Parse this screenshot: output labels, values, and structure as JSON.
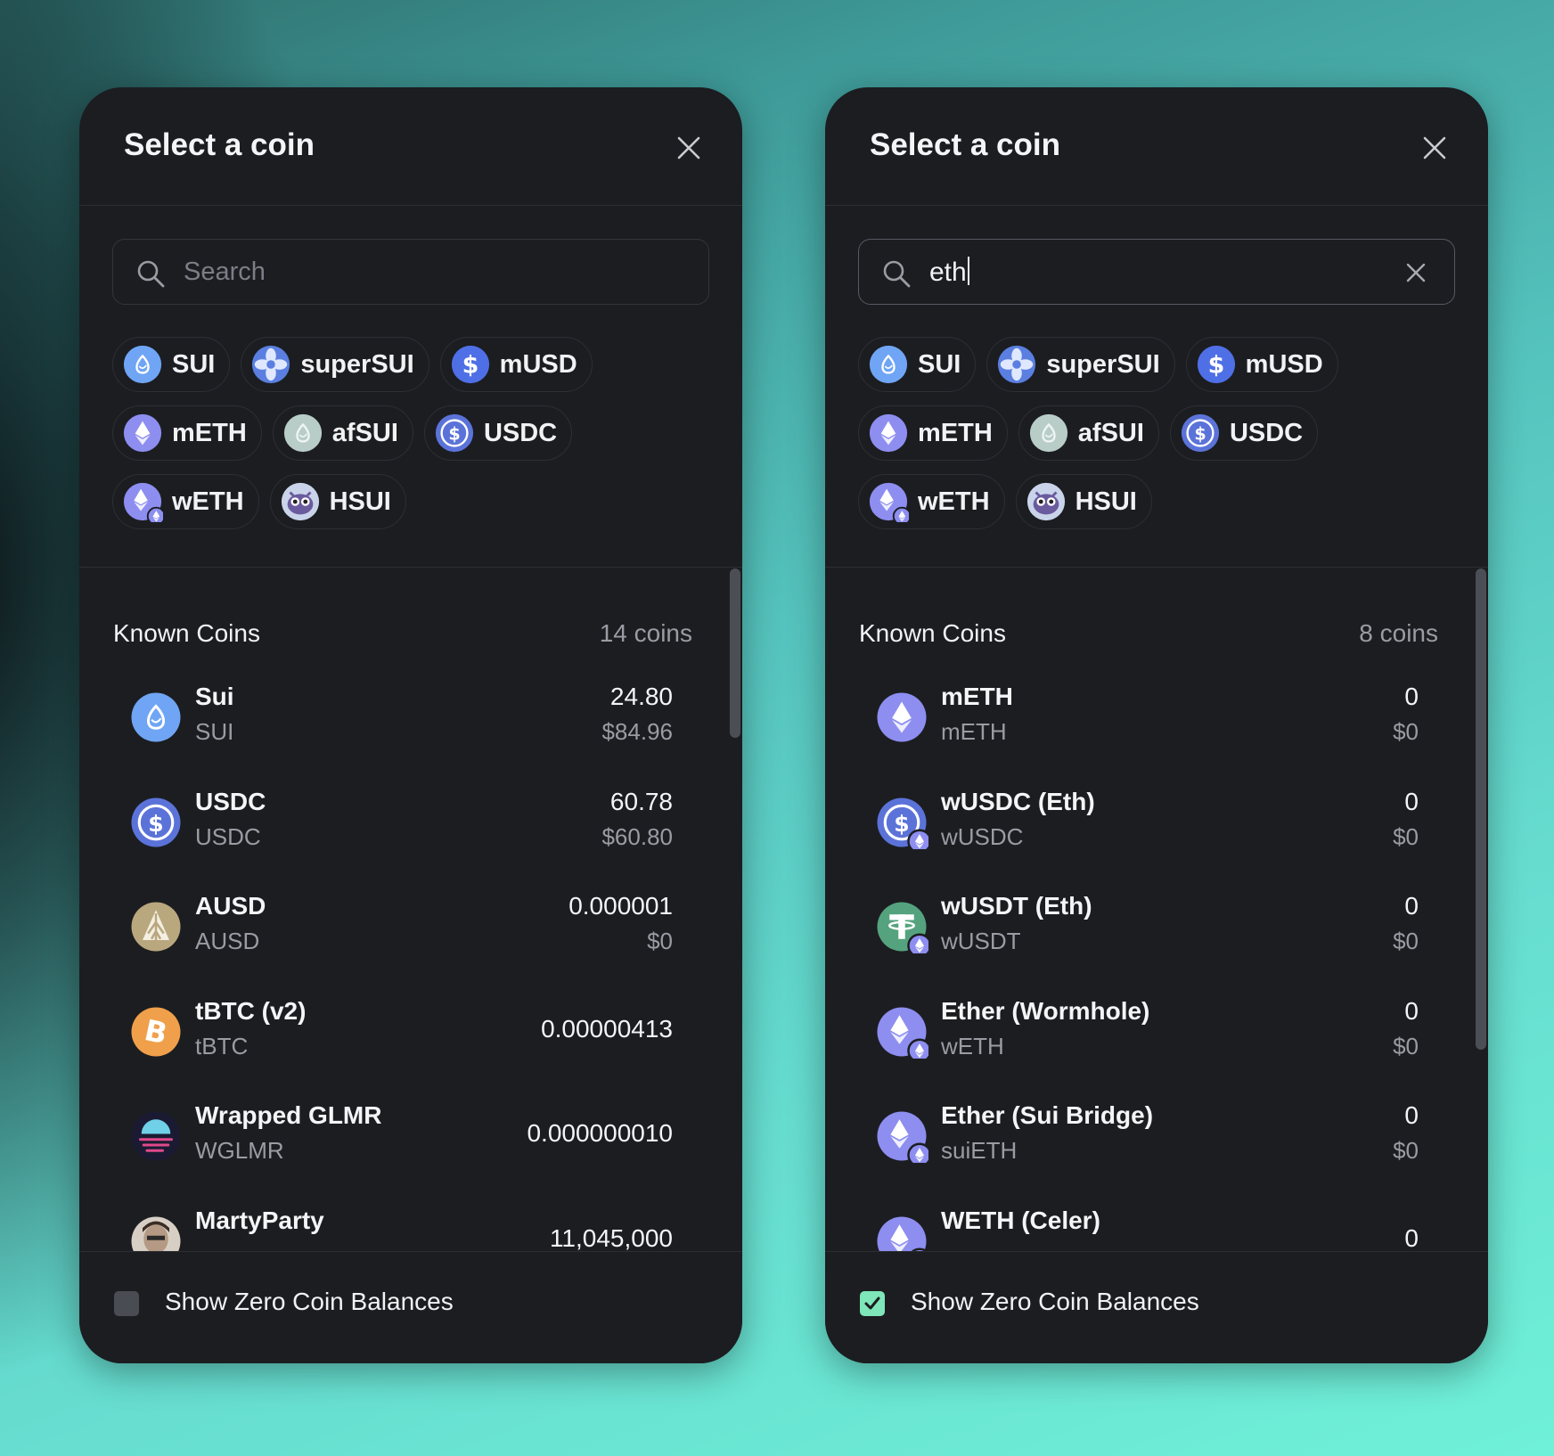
{
  "colors": {
    "sui": "#6fa5f4",
    "eth": "#8d8ef0",
    "usdc": "#5b73d9",
    "ausd": "#b9a77e",
    "tbtc": "#f0a04b",
    "usdt": "#54a37e",
    "checkbox_on": "#7ee6b8"
  },
  "left": {
    "title": "Select a coin",
    "search": {
      "placeholder": "Search",
      "value": ""
    },
    "chips_rows": [
      [
        {
          "label": "SUI",
          "icon": "sui-icon"
        },
        {
          "label": "superSUI",
          "icon": "supersui-icon"
        },
        {
          "label": "mUSD",
          "icon": "musd-icon"
        }
      ],
      [
        {
          "label": "mETH",
          "icon": "meth-icon"
        },
        {
          "label": "afSUI",
          "icon": "afsui-icon"
        },
        {
          "label": "USDC",
          "icon": "usdc-icon"
        }
      ],
      [
        {
          "label": "wETH",
          "icon": "weth-icon"
        },
        {
          "label": "HSUI",
          "icon": "hsui-icon"
        }
      ]
    ],
    "list_title": "Known Coins",
    "count": "14 coins",
    "coins": [
      {
        "name": "Sui",
        "symbol": "SUI",
        "balance": "24.80",
        "usd": "$84.96",
        "icon": "sui-icon"
      },
      {
        "name": "USDC",
        "symbol": "USDC",
        "balance": "60.78",
        "usd": "$60.80",
        "icon": "usdc-icon"
      },
      {
        "name": "AUSD",
        "symbol": "AUSD",
        "balance": "0.000001",
        "usd": "$0",
        "icon": "ausd-icon"
      },
      {
        "name": "tBTC (v2)",
        "symbol": "tBTC",
        "balance": "0.00000413",
        "usd": "",
        "icon": "tbtc-icon"
      },
      {
        "name": "Wrapped GLMR",
        "symbol": "WGLMR",
        "balance": "0.000000010",
        "usd": "",
        "icon": "glmr-icon"
      },
      {
        "name": "MartyParty",
        "symbol": "",
        "balance": "11,045,000",
        "usd": "",
        "icon": "martyparty-avatar-icon"
      }
    ],
    "zero_label": "Show Zero Coin Balances",
    "zero_checked": false,
    "scroll_fraction": 0.24
  },
  "right": {
    "title": "Select a coin",
    "search": {
      "placeholder": "Search",
      "value": "eth"
    },
    "chips_rows": [
      [
        {
          "label": "SUI",
          "icon": "sui-icon"
        },
        {
          "label": "superSUI",
          "icon": "supersui-icon"
        },
        {
          "label": "mUSD",
          "icon": "musd-icon"
        }
      ],
      [
        {
          "label": "mETH",
          "icon": "meth-icon"
        },
        {
          "label": "afSUI",
          "icon": "afsui-icon"
        },
        {
          "label": "USDC",
          "icon": "usdc-icon"
        }
      ],
      [
        {
          "label": "wETH",
          "icon": "weth-icon"
        },
        {
          "label": "HSUI",
          "icon": "hsui-icon"
        }
      ]
    ],
    "list_title": "Known Coins",
    "count": "8 coins",
    "coins": [
      {
        "name": "mETH",
        "symbol": "mETH",
        "balance": "0",
        "usd": "$0",
        "icon": "meth-icon"
      },
      {
        "name": "wUSDC (Eth)",
        "symbol": "wUSDC",
        "balance": "0",
        "usd": "$0",
        "icon": "wusdc-icon"
      },
      {
        "name": "wUSDT (Eth)",
        "symbol": "wUSDT",
        "balance": "0",
        "usd": "$0",
        "icon": "wusdt-icon"
      },
      {
        "name": "Ether (Wormhole)",
        "symbol": "wETH",
        "balance": "0",
        "usd": "$0",
        "icon": "weth-icon"
      },
      {
        "name": "Ether (Sui Bridge)",
        "symbol": "suiETH",
        "balance": "0",
        "usd": "$0",
        "icon": "suieth-icon"
      },
      {
        "name": "WETH (Celer)",
        "symbol": "",
        "balance": "0",
        "usd": "",
        "icon": "weth-celer-icon"
      }
    ],
    "zero_label": "Show Zero Coin Balances",
    "zero_checked": true,
    "scroll_fraction": 0.64
  }
}
